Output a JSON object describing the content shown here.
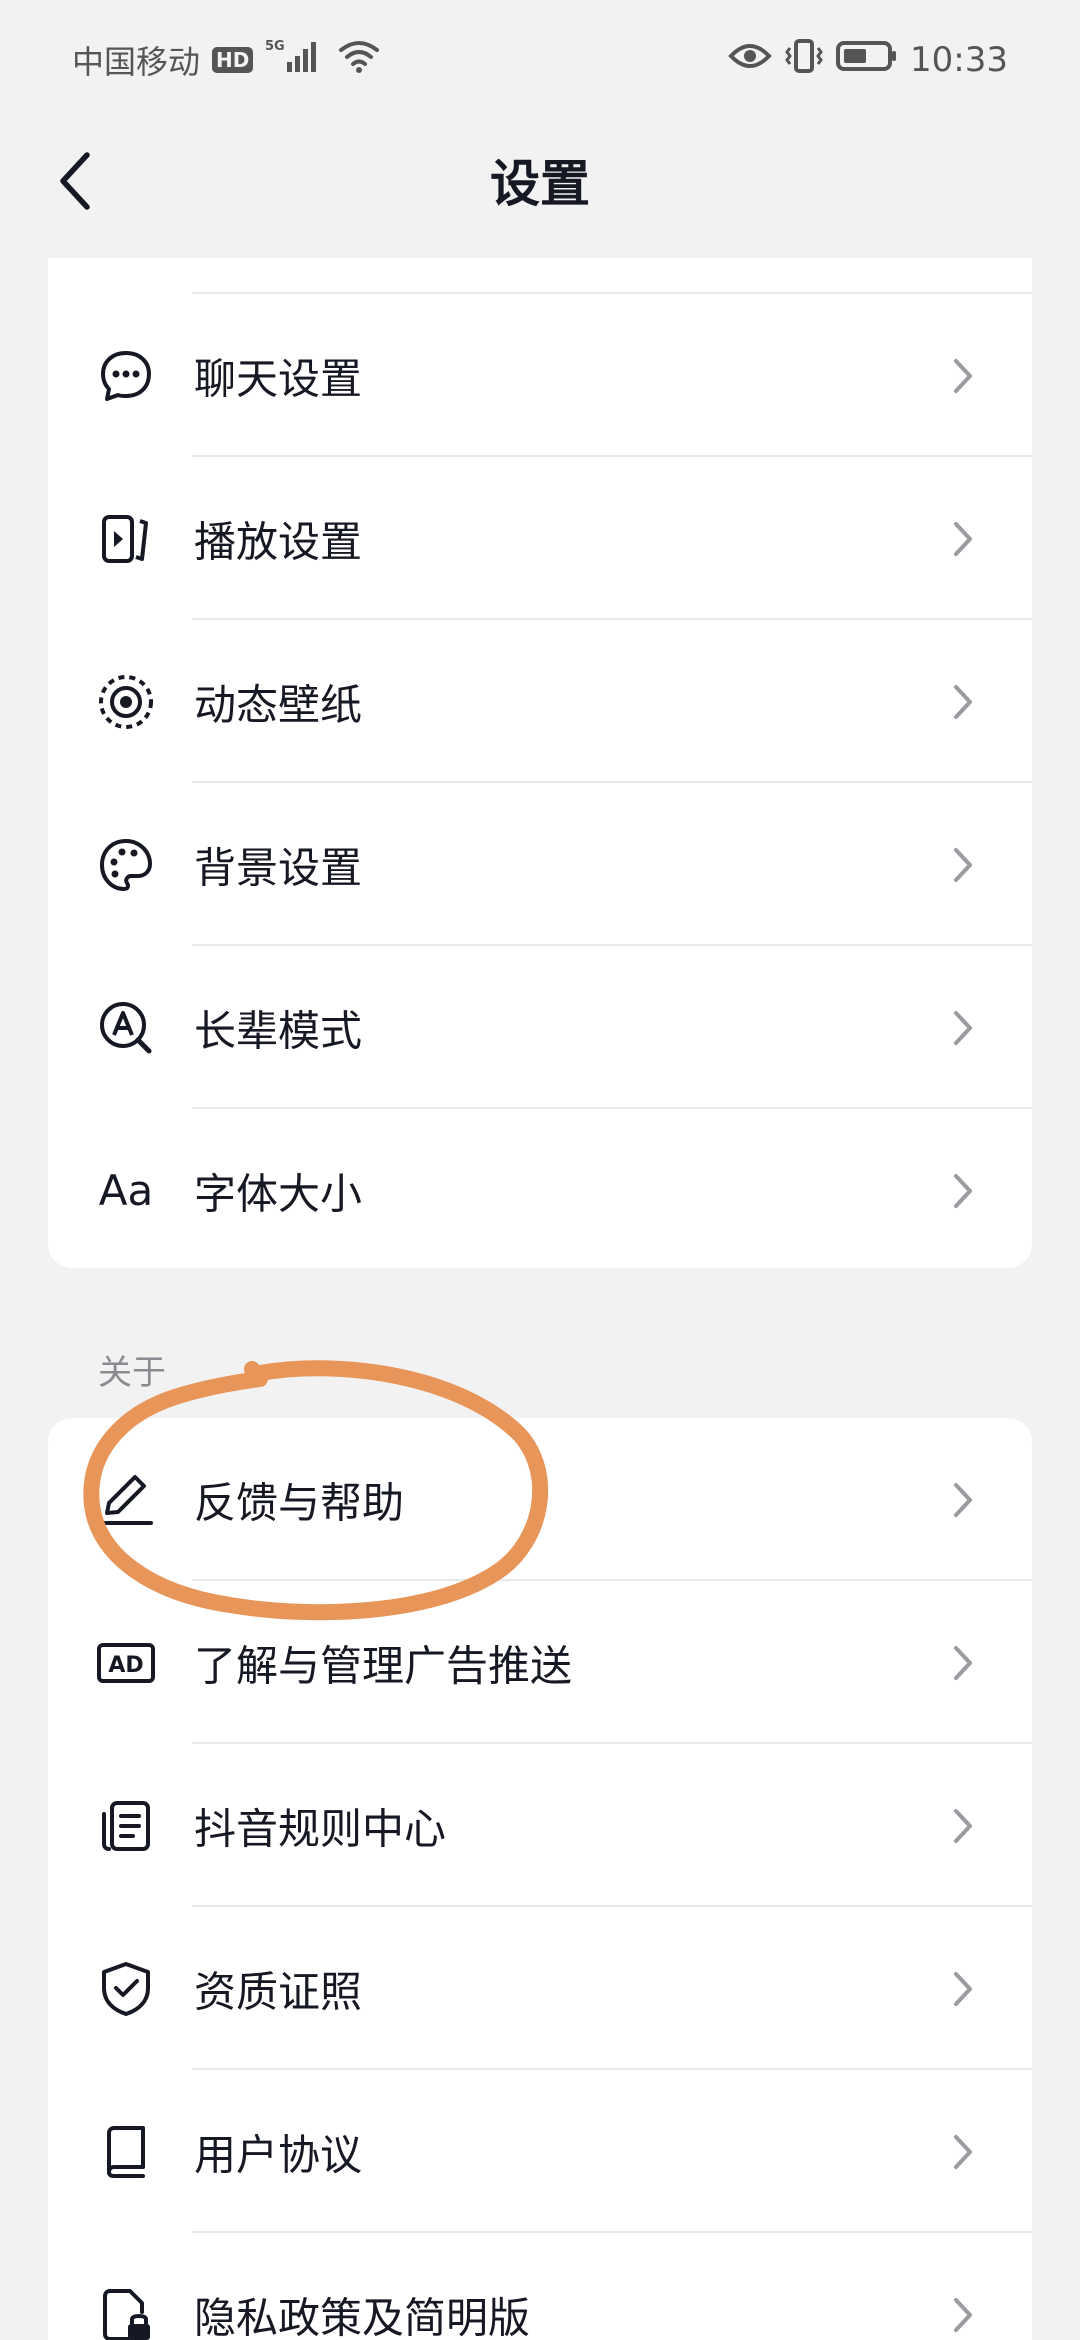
{
  "status_bar": {
    "carrier": "中国移动",
    "hd_badge": "HD",
    "network": "5G",
    "time": "10:33"
  },
  "header": {
    "title": "设置",
    "back_icon": "chevron-left-icon"
  },
  "display_section": {
    "items": [
      {
        "label": "聊天设置",
        "icon": "chat-bubble-icon"
      },
      {
        "label": "播放设置",
        "icon": "play-settings-icon"
      },
      {
        "label": "动态壁纸",
        "icon": "live-wallpaper-icon"
      },
      {
        "label": "背景设置",
        "icon": "palette-icon"
      },
      {
        "label": "长辈模式",
        "icon": "elder-mode-icon"
      },
      {
        "label": "字体大小",
        "icon": "font-size-icon",
        "icon_text": "Aa"
      }
    ]
  },
  "about_section": {
    "title": "关于",
    "items": [
      {
        "label": "反馈与帮助",
        "icon": "edit-pen-icon"
      },
      {
        "label": "了解与管理广告推送",
        "icon": "ad-icon",
        "icon_text": "AD"
      },
      {
        "label": "抖音规则中心",
        "icon": "document-list-icon"
      },
      {
        "label": "资质证照",
        "icon": "shield-check-icon"
      },
      {
        "label": "用户协议",
        "icon": "book-icon"
      },
      {
        "label": "隐私政策及简明版",
        "icon": "privacy-lock-icon"
      }
    ]
  },
  "colors": {
    "background": "#f2f2f2",
    "card": "#ffffff",
    "text_primary": "#161823",
    "text_secondary": "#8a8b91",
    "chevron": "#9a9aa0",
    "annotation": "#e8955a"
  }
}
